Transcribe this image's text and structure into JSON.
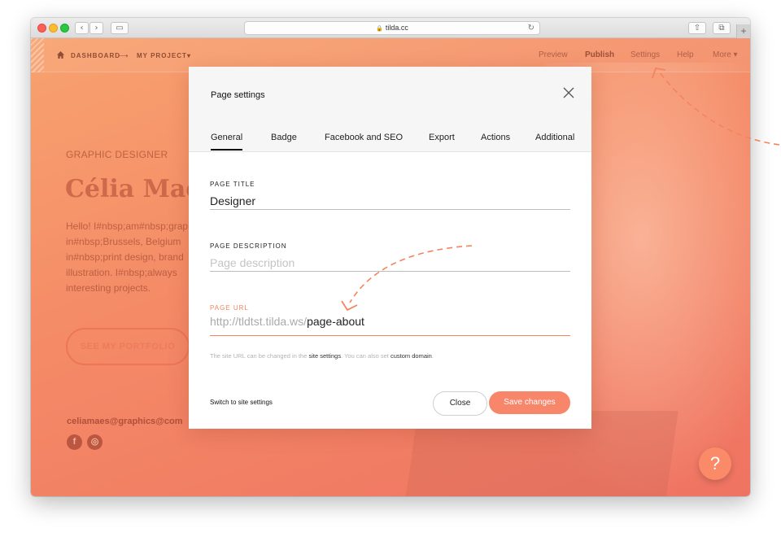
{
  "browser": {
    "url": "tilda.cc",
    "back_glyph": "‹",
    "forward_glyph": "›",
    "sidebar_glyph": "▭",
    "reload_glyph": "↻",
    "share_glyph": "⇧",
    "tabs_glyph": "⧉",
    "new_tab_glyph": "+"
  },
  "topnav": {
    "breadcrumb": [
      "DASHBOARD",
      "MY PROJECT"
    ],
    "breadcrumb_arrow": "⟶",
    "breadcrumb_caret": "▾",
    "links": {
      "preview": "Preview",
      "publish": "Publish",
      "settings": "Settings",
      "help": "Help",
      "more": "More ▾"
    }
  },
  "background_page": {
    "eyebrow": "GRAPHIC DESIGNER",
    "name": "Célia Mae",
    "bio": "Hello! I#nbsp;am#nbsp;graphic in#nbsp;Brussels, Belgium in#nbsp;print design, brand illustration. I#nbsp;always interesting projects.",
    "cta": "SEE MY PORTFOLIO",
    "email": "celiamaes@graphics@com",
    "social": {
      "facebook": "f",
      "instagram": "◎"
    },
    "help_fab": "?"
  },
  "modal": {
    "title": "Page settings",
    "tabs": [
      "General",
      "Badge",
      "Facebook and SEO",
      "Export",
      "Actions",
      "Additional"
    ],
    "active_tab": "General",
    "fields": {
      "page_title": {
        "label": "PAGE TITLE",
        "value": "Designer"
      },
      "page_description": {
        "label": "PAGE DESCRIPTION",
        "value": "",
        "placeholder": "Page description"
      },
      "page_url": {
        "label": "PAGE URL",
        "prefix": "http://tldtst.tilda.ws/",
        "value": "page-about"
      }
    },
    "hint": {
      "part1": "The site URL can be changed in the ",
      "link1": "site settings",
      "part2": ". You can also set ",
      "link2": "custom domain",
      "part3": "."
    },
    "switch_link": "Switch to site settings",
    "close_label": "Close",
    "save_label": "Save changes"
  },
  "colors": {
    "accent": "#f8866a",
    "page_gradient_start": "#f8a26f",
    "page_gradient_end": "#ef7362",
    "arrow": "#f4845f"
  }
}
